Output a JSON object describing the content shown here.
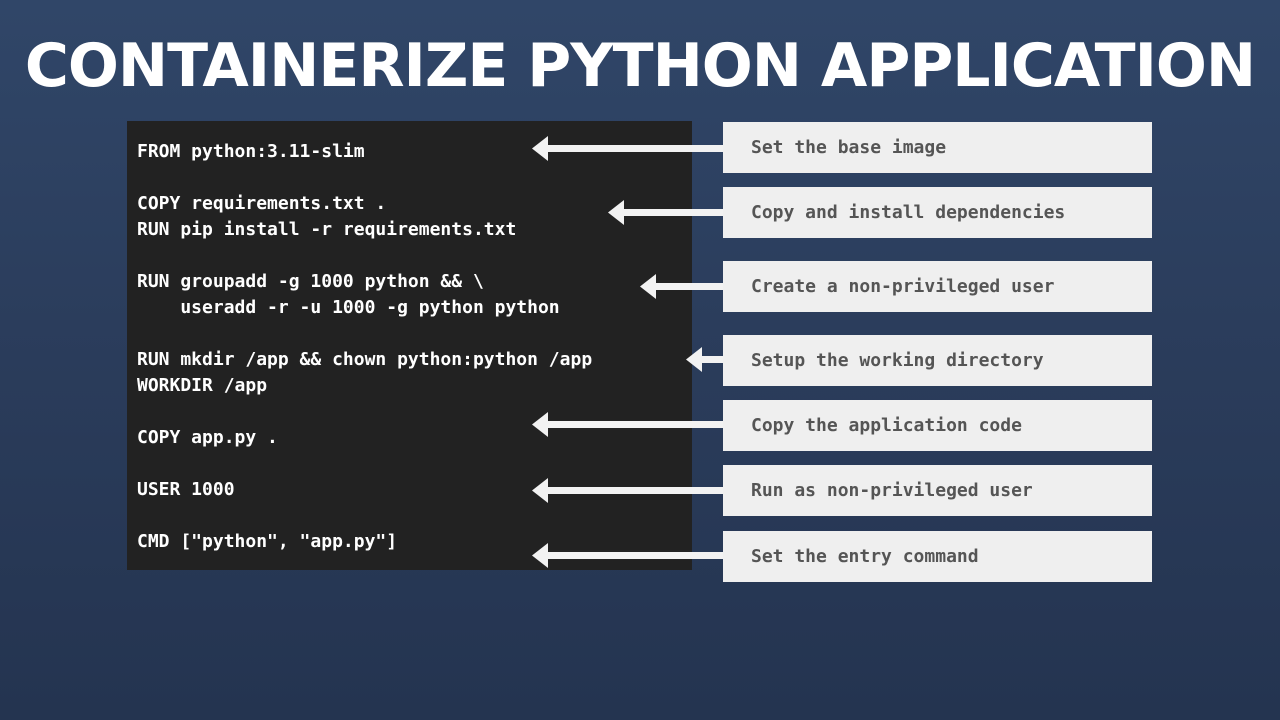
{
  "title": "CONTAINERIZE PYTHON APPLICATION",
  "code_lines": [
    "FROM python:3.11-slim",
    "COPY requirements.txt .",
    "RUN pip install -r requirements.txt",
    "RUN groupadd -g 1000 python && \\",
    "    useradd -r -u 1000 -g python python",
    "RUN mkdir /app && chown python:python /app",
    "WORKDIR /app",
    "COPY app.py .",
    "USER 1000",
    "CMD [\"python\", \"app.py\"]"
  ],
  "callouts": [
    "Set the base image",
    "Copy and install dependencies",
    "Create a non-privileged user",
    "Setup the working directory",
    "Copy the application code",
    "Run as non-privileged user",
    "Set the entry command"
  ],
  "colors": {
    "background": "#2b3d5c",
    "code_background": "#222222",
    "code_text": "#ffffff",
    "callout_background": "#efefef",
    "callout_text": "#555555",
    "arrow": "#f2f2f2"
  }
}
